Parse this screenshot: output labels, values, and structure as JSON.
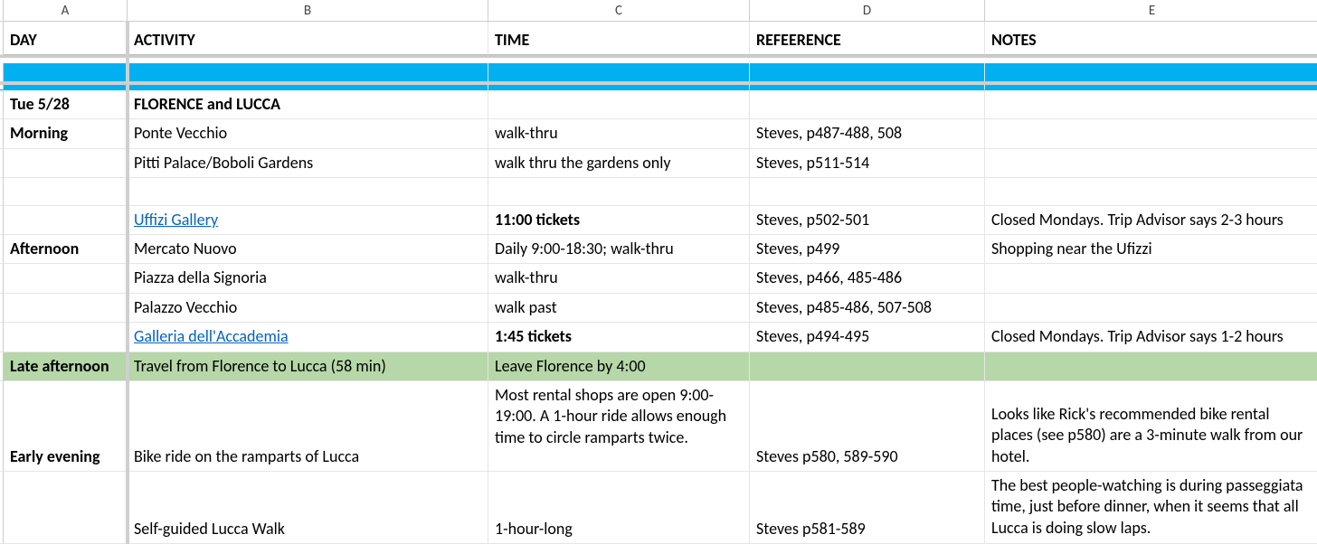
{
  "columns": {
    "A": "A",
    "B": "B",
    "C": "C",
    "D": "D",
    "E": "E"
  },
  "headers": {
    "day": "DAY",
    "activity": "ACTIVITY",
    "time": "TIME",
    "reference": "REFEERENCE",
    "notes": "NOTES"
  },
  "rows": [
    {
      "a": "Tue 5/28",
      "aBold": true,
      "b": "FLORENCE and LUCCA",
      "bBold": true,
      "c": "",
      "d": "",
      "e": ""
    },
    {
      "a": "Morning",
      "aBold": true,
      "b": "Ponte Vecchio",
      "c": "walk-thru",
      "d": "Steves, p487-488, 508",
      "e": ""
    },
    {
      "a": "",
      "b": "Pitti Palace/Boboli Gardens",
      "c": "walk thru the gardens only",
      "d": "Steves, p511-514",
      "e": ""
    },
    {
      "a": "",
      "b": "",
      "c": "",
      "d": "",
      "e": ""
    },
    {
      "a": "",
      "b": "Uffizi Gallery",
      "bLink": true,
      "c": "11:00 tickets",
      "cBold": true,
      "d": "Steves, p502-501",
      "e": "Closed Mondays. Trip Advisor says 2-3 hours",
      "eNowrap": true
    },
    {
      "a": "Afternoon",
      "aBold": true,
      "b": "Mercato Nuovo",
      "c": "Daily 9:00-18:30; walk-thru",
      "d": "Steves, p499",
      "e": "Shopping near the Ufizzi"
    },
    {
      "a": "",
      "b": "Piazza della Signoria",
      "c": "walk-thru",
      "d": "Steves, p466, 485-486",
      "e": ""
    },
    {
      "a": "",
      "b": "Palazzo Vecchio",
      "c": "walk past",
      "d": "Steves, p485-486, 507-508",
      "e": ""
    },
    {
      "a": "",
      "b": "Galleria dell'Accademia",
      "bLink": true,
      "c": "1:45 tickets",
      "cBold": true,
      "d": "Steves, p494-495",
      "e": "Closed Mondays. Trip Advisor says 1-2 hours",
      "eNowrap": true
    },
    {
      "a": "Late afternoon",
      "aBold": true,
      "b": "Travel from Florence to Lucca (58 min)",
      "c": "Leave Florence by 4:00",
      "d": "",
      "e": "",
      "green": true
    },
    {
      "a": "Early evening",
      "aBold": true,
      "b": "Bike ride on the ramparts of Lucca",
      "c": "Most rental shops are open 9:00-19:00. A 1-hour ride allows enough time to circle ramparts twice.",
      "d": "Steves p580, 589-590",
      "e": "Looks like Rick's recommended bike rental places (see p580) are a 3-minute walk from our hotel.",
      "tall": true
    },
    {
      "a": "",
      "b": "Self-guided Lucca Walk",
      "c": "1-hour-long",
      "d": "Steves p581-589",
      "e": "The best people-watching is during passeggiata time, just before dinner, when it seems that all Lucca is doing slow laps.",
      "tall2": true
    }
  ]
}
